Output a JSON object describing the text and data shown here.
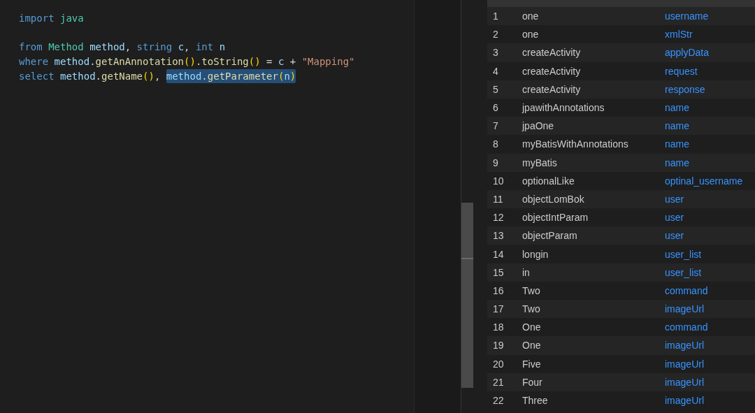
{
  "editor": {
    "lines": [
      {
        "kind": "code",
        "segments": [
          {
            "selected": false,
            "tokens": [
              {
                "text": "import ",
                "kind": "keyword"
              },
              {
                "text": "java",
                "kind": "type"
              }
            ]
          }
        ]
      },
      {
        "kind": "blank"
      },
      {
        "kind": "code",
        "segments": [
          {
            "selected": false,
            "tokens": [
              {
                "text": "from ",
                "kind": "keyword"
              },
              {
                "text": "Method ",
                "kind": "type"
              },
              {
                "text": "method",
                "kind": "variable"
              },
              {
                "text": ", ",
                "kind": "plain"
              },
              {
                "text": "string ",
                "kind": "keyword"
              },
              {
                "text": "c",
                "kind": "variable"
              },
              {
                "text": ", ",
                "kind": "plain"
              },
              {
                "text": "int ",
                "kind": "keyword"
              },
              {
                "text": "n",
                "kind": "variable"
              }
            ]
          }
        ]
      },
      {
        "kind": "code",
        "segments": [
          {
            "selected": false,
            "tokens": [
              {
                "text": "where ",
                "kind": "keyword"
              },
              {
                "text": "method",
                "kind": "variable"
              },
              {
                "text": ".",
                "kind": "plain"
              },
              {
                "text": "getAnAnnotation",
                "kind": "function"
              },
              {
                "text": "()",
                "kind": "paren"
              },
              {
                "text": ".",
                "kind": "plain"
              },
              {
                "text": "toString",
                "kind": "function"
              },
              {
                "text": "()",
                "kind": "paren"
              },
              {
                "text": " = ",
                "kind": "plain"
              },
              {
                "text": "c",
                "kind": "variable"
              },
              {
                "text": " + ",
                "kind": "plain"
              },
              {
                "text": "\"Mapping\"",
                "kind": "string"
              }
            ]
          }
        ]
      },
      {
        "kind": "code",
        "segments": [
          {
            "selected": false,
            "tokens": [
              {
                "text": "select ",
                "kind": "keyword"
              },
              {
                "text": "method",
                "kind": "variable"
              },
              {
                "text": ".",
                "kind": "plain"
              },
              {
                "text": "getName",
                "kind": "function"
              },
              {
                "text": "()",
                "kind": "paren"
              },
              {
                "text": ", ",
                "kind": "plain"
              }
            ]
          },
          {
            "selected": true,
            "tokens": [
              {
                "text": "method",
                "kind": "variable"
              },
              {
                "text": ".",
                "kind": "plain"
              },
              {
                "text": "getParameter",
                "kind": "function"
              },
              {
                "text": "(",
                "kind": "paren"
              },
              {
                "text": "n",
                "kind": "variable"
              },
              {
                "text": ")",
                "kind": "paren"
              }
            ]
          }
        ]
      }
    ]
  },
  "results": {
    "rows": [
      {
        "index": "1",
        "column_1": "one",
        "column_2": "username"
      },
      {
        "index": "2",
        "column_1": "one",
        "column_2": "xmlStr"
      },
      {
        "index": "3",
        "column_1": "createActivity",
        "column_2": "applyData"
      },
      {
        "index": "4",
        "column_1": "createActivity",
        "column_2": "request"
      },
      {
        "index": "5",
        "column_1": "createActivity",
        "column_2": "response"
      },
      {
        "index": "6",
        "column_1": "jpawithAnnotations",
        "column_2": "name"
      },
      {
        "index": "7",
        "column_1": "jpaOne",
        "column_2": "name"
      },
      {
        "index": "8",
        "column_1": "myBatisWithAnnotations",
        "column_2": "name"
      },
      {
        "index": "9",
        "column_1": "myBatis",
        "column_2": "name"
      },
      {
        "index": "10",
        "column_1": "optionalLike",
        "column_2": "optinal_username"
      },
      {
        "index": "11",
        "column_1": "objectLomBok",
        "column_2": "user"
      },
      {
        "index": "12",
        "column_1": "objectIntParam",
        "column_2": "user"
      },
      {
        "index": "13",
        "column_1": "objectParam",
        "column_2": "user"
      },
      {
        "index": "14",
        "column_1": "longin",
        "column_2": "user_list"
      },
      {
        "index": "15",
        "column_1": "in",
        "column_2": "user_list"
      },
      {
        "index": "16",
        "column_1": "Two",
        "column_2": "command"
      },
      {
        "index": "17",
        "column_1": "Two",
        "column_2": "imageUrl"
      },
      {
        "index": "18",
        "column_1": "One",
        "column_2": "command"
      },
      {
        "index": "19",
        "column_1": "One",
        "column_2": "imageUrl"
      },
      {
        "index": "20",
        "column_1": "Five",
        "column_2": "imageUrl"
      },
      {
        "index": "21",
        "column_1": "Four",
        "column_2": "imageUrl"
      },
      {
        "index": "22",
        "column_1": "Three",
        "column_2": "imageUrl"
      }
    ]
  }
}
